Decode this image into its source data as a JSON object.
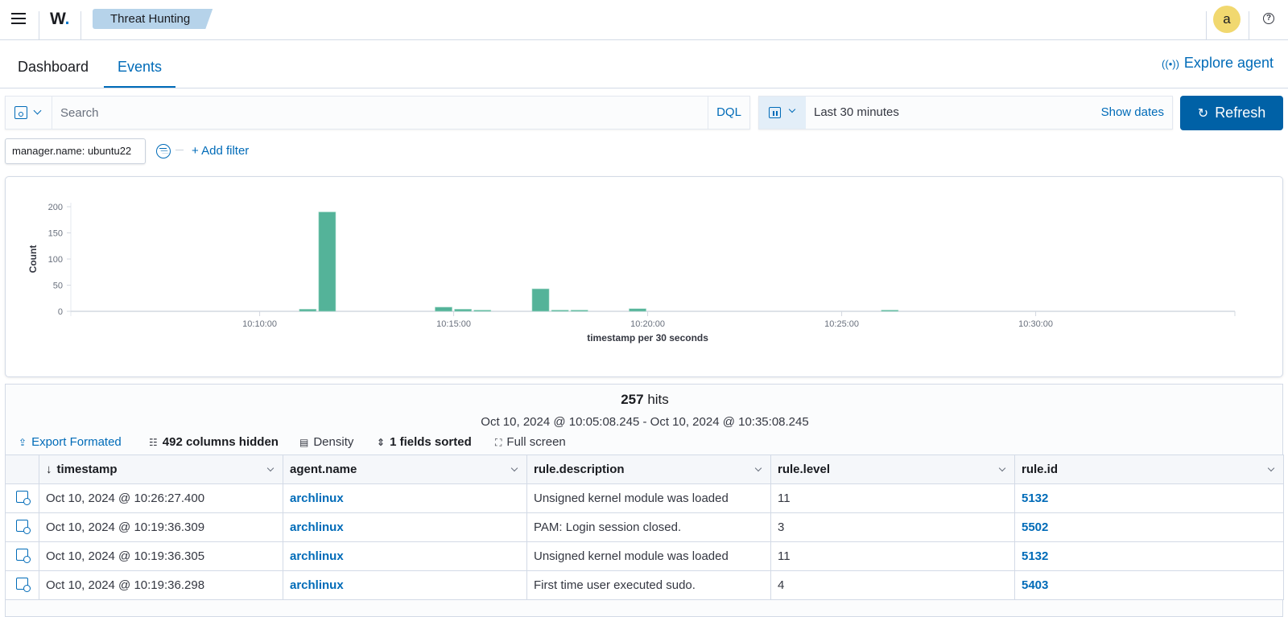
{
  "header": {
    "logo_text": "W",
    "logo_dot": ".",
    "breadcrumb": "Threat Hunting",
    "avatar_letter": "a",
    "help_glyph": "?"
  },
  "tabs": [
    {
      "label": "Dashboard",
      "active": false
    },
    {
      "label": "Events",
      "active": true
    }
  ],
  "explore_agent": {
    "icon": "((•))",
    "label": "Explore agent"
  },
  "query": {
    "placeholder": "Search",
    "value": "",
    "language": "DQL"
  },
  "date_picker": {
    "range": "Last 30 minutes",
    "show_dates": "Show dates"
  },
  "refresh": {
    "icon": "↻",
    "label": "Refresh"
  },
  "filters": {
    "pills": [
      "manager.name: ubuntu22"
    ],
    "add_filter": "+ Add filter"
  },
  "chart_data": {
    "type": "bar",
    "title": "",
    "xlabel": "timestamp per 30 seconds",
    "ylabel": "Count",
    "ylim": [
      0,
      200
    ],
    "yticks": [
      0,
      50,
      100,
      150,
      200
    ],
    "xrange": [
      "10:05:08",
      "10:35:08"
    ],
    "xticks": [
      "10:10:00",
      "10:15:00",
      "10:20:00",
      "10:25:00",
      "10:30:00"
    ],
    "color": "#54b399",
    "grid": false,
    "legend": "none",
    "x": [
      "10:11:00",
      "10:11:30",
      "10:14:30",
      "10:15:00",
      "10:15:30",
      "10:17:00",
      "10:17:30",
      "10:18:00",
      "10:19:30",
      "10:26:00"
    ],
    "values": [
      4,
      190,
      8,
      4,
      1,
      43,
      1,
      1,
      5,
      1
    ]
  },
  "results": {
    "hits_count": "257",
    "hits_label": " hits",
    "range": "Oct 10, 2024 @ 10:05:08.245 - Oct 10, 2024 @ 10:35:08.245",
    "toolbar": {
      "export": "Export Formated",
      "columns_hidden": "492 columns hidden",
      "density": "Density",
      "sorted": "1 fields sorted",
      "fullscreen": "Full screen"
    },
    "columns": [
      "timestamp",
      "agent.name",
      "rule.description",
      "rule.level",
      "rule.id"
    ],
    "sort_indicator": "↓",
    "rows": [
      {
        "timestamp": "Oct 10, 2024 @ 10:26:27.400",
        "agent": "archlinux",
        "description": "Unsigned kernel module was loaded",
        "level": "11",
        "id": "5132"
      },
      {
        "timestamp": "Oct 10, 2024 @ 10:19:36.309",
        "agent": "archlinux",
        "description": "PAM: Login session closed.",
        "level": "3",
        "id": "5502"
      },
      {
        "timestamp": "Oct 10, 2024 @ 10:19:36.305",
        "agent": "archlinux",
        "description": "Unsigned kernel module was loaded",
        "level": "11",
        "id": "5132"
      },
      {
        "timestamp": "Oct 10, 2024 @ 10:19:36.298",
        "agent": "archlinux",
        "description": "First time user executed sudo.",
        "level": "4",
        "id": "5403"
      }
    ]
  }
}
